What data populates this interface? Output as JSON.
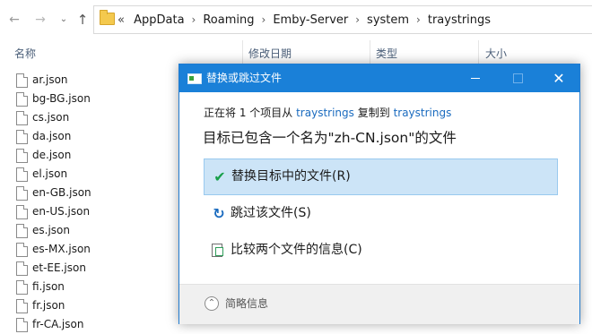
{
  "explorer": {
    "nav": {
      "back": "←",
      "forward": "→",
      "dropdown": "⌄",
      "up": "↑"
    },
    "breadcrumb": {
      "overflow": "«",
      "items": [
        "AppData",
        "Roaming",
        "Emby-Server",
        "system",
        "traystrings"
      ]
    },
    "columns": {
      "name": "名称",
      "date_modified": "修改日期",
      "type": "类型",
      "size": "大小"
    },
    "files": [
      "ar.json",
      "bg-BG.json",
      "cs.json",
      "da.json",
      "de.json",
      "el.json",
      "en-GB.json",
      "en-US.json",
      "es.json",
      "es-MX.json",
      "et-EE.json",
      "fi.json",
      "fr.json",
      "fr-CA.json"
    ]
  },
  "dialog": {
    "title": "替换或跳过文件",
    "progress_prefix": "正在将 1 个项目从",
    "source_folder": "traystrings",
    "copy_to": "复制到",
    "dest_folder": "traystrings",
    "message": "目标已包含一个名为\"zh-CN.json\"的文件",
    "options": {
      "replace": "替换目标中的文件(R)",
      "skip": "跳过该文件(S)",
      "compare": "比较两个文件的信息(C)"
    },
    "footer": {
      "more_info": "简略信息"
    },
    "window_buttons": {
      "minimize": "—",
      "maximize": "□",
      "close": "✕"
    }
  },
  "colors": {
    "titlebar": "#1a80d8",
    "selection": "#cce4f7",
    "link": "#1a6bbf",
    "check": "#19a04b"
  }
}
